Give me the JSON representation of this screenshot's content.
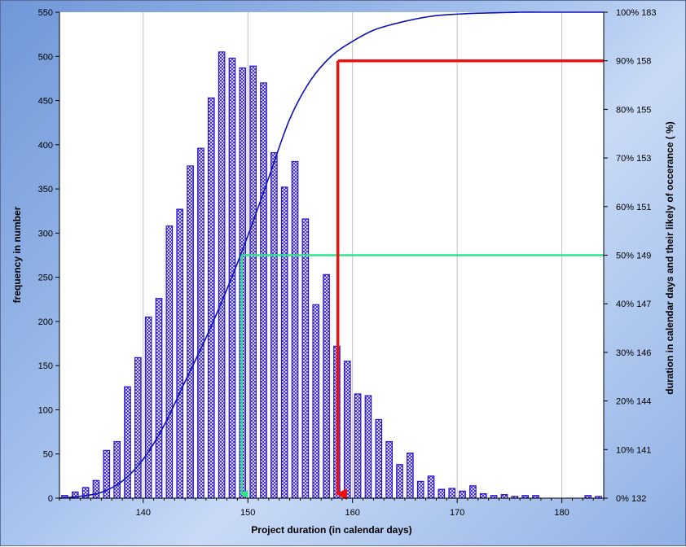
{
  "chart_data": {
    "type": "bar",
    "xlabel": "Project duration (in calendar days)",
    "ylabel": "frequency in number",
    "y2label": "duration in calendar days and their likely of occerance ( %)",
    "xlim": [
      132,
      184
    ],
    "ylim": [
      0,
      550
    ],
    "x_ticks": [
      140,
      150,
      160,
      170,
      180
    ],
    "y_ticks": [
      0,
      50,
      100,
      150,
      200,
      250,
      300,
      350,
      400,
      450,
      500,
      550
    ],
    "y2_ticks": [
      {
        "pct": 0,
        "label": "0%",
        "days": "132"
      },
      {
        "pct": 10,
        "label": "10%",
        "days": "141"
      },
      {
        "pct": 20,
        "label": "20%",
        "days": "144"
      },
      {
        "pct": 30,
        "label": "30%",
        "days": "146"
      },
      {
        "pct": 40,
        "label": "40%",
        "days": "147"
      },
      {
        "pct": 50,
        "label": "50%",
        "days": "149"
      },
      {
        "pct": 60,
        "label": "60%",
        "days": "151"
      },
      {
        "pct": 70,
        "label": "70%",
        "days": "153"
      },
      {
        "pct": 80,
        "label": "80%",
        "days": "155"
      },
      {
        "pct": 90,
        "label": "90%",
        "days": "158"
      },
      {
        "pct": 100,
        "label": "100%",
        "days": "183"
      }
    ],
    "grid": "vertical",
    "series": [
      {
        "kind": "histogram",
        "color": "#2a14c8",
        "x": [
          132.5,
          133.5,
          134.5,
          135.5,
          136.5,
          137.5,
          138.5,
          139.5,
          140.5,
          141.5,
          142.5,
          143.5,
          144.5,
          145.5,
          146.5,
          147.5,
          148.5,
          149.5,
          150.5,
          151.5,
          152.5,
          153.5,
          154.5,
          155.5,
          156.5,
          157.5,
          158.5,
          159.5,
          160.5,
          161.5,
          162.5,
          163.5,
          164.5,
          165.5,
          166.5,
          167.5,
          168.5,
          169.5,
          170.5,
          171.5,
          172.5,
          173.5,
          174.5,
          175.5,
          176.5,
          177.5,
          178.5,
          179.5,
          180.5,
          181.5,
          182.5,
          183.5
        ],
        "values": [
          3,
          7,
          12,
          20,
          54,
          64,
          126,
          159,
          205,
          226,
          308,
          327,
          376,
          396,
          453,
          505,
          498,
          487,
          489,
          470,
          391,
          352,
          381,
          316,
          219,
          253,
          172,
          155,
          118,
          116,
          89,
          64,
          38,
          51,
          19,
          25,
          10,
          11,
          8,
          14,
          5,
          3,
          4,
          2,
          3,
          3,
          0,
          0,
          0,
          0,
          3,
          2
        ]
      },
      {
        "kind": "cumulative-line",
        "color": "#1010b8",
        "x": [
          132,
          134,
          136,
          138,
          140,
          142,
          144,
          146,
          148,
          150,
          152,
          154,
          156,
          158,
          160,
          162,
          164,
          166,
          168,
          170,
          172,
          174,
          176,
          178,
          180,
          182,
          184
        ],
        "values": [
          0,
          0.4,
          1.2,
          3.5,
          8,
          15,
          24,
          33,
          43,
          54,
          66,
          78,
          86,
          91,
          94,
          96.3,
          97.6,
          98.6,
          99.3,
          99.6,
          99.8,
          99.9,
          100,
          100,
          100,
          100,
          100
        ]
      }
    ],
    "annotations": [
      {
        "kind": "percentile-marker",
        "pct": 50,
        "x": 149.4,
        "color": "#2ee68a"
      },
      {
        "kind": "percentile-marker",
        "pct": 90,
        "x": 158.6,
        "color": "#ee1111"
      }
    ]
  }
}
